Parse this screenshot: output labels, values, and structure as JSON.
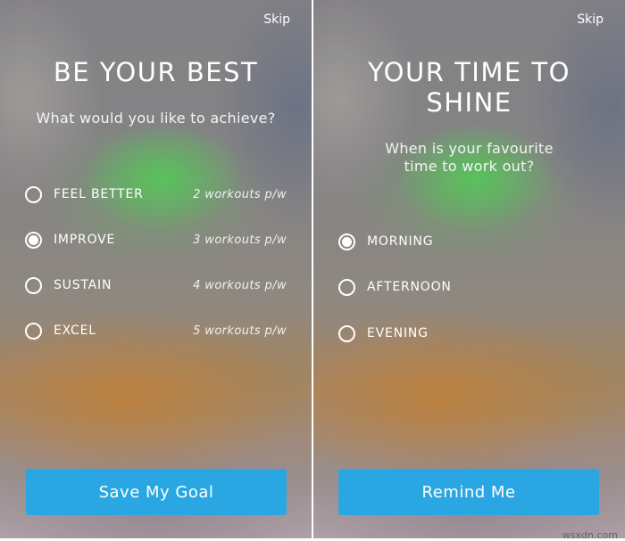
{
  "goal_screen": {
    "skip_label": "Skip",
    "title": "BE YOUR BEST",
    "subtitle": "What would you like to achieve?",
    "options": [
      {
        "label": "FEEL BETTER",
        "meta": "2 workouts p/w",
        "selected": false
      },
      {
        "label": "IMPROVE",
        "meta": "3 workouts p/w",
        "selected": true
      },
      {
        "label": "SUSTAIN",
        "meta": "4 workouts p/w",
        "selected": false
      },
      {
        "label": "EXCEL",
        "meta": "5 workouts p/w",
        "selected": false
      }
    ],
    "button_label": "Save My Goal"
  },
  "time_screen": {
    "skip_label": "Skip",
    "title_line1": "YOUR TIME TO",
    "title_line2": "SHINE",
    "subtitle_line1": "When is your favourite",
    "subtitle_line2": "time to work out?",
    "options": [
      {
        "label": "MORNING",
        "selected": true
      },
      {
        "label": "AFTERNOON",
        "selected": false
      },
      {
        "label": "EVENING",
        "selected": false
      }
    ],
    "button_label": "Remind Me"
  },
  "watermark": "wsxdn.com",
  "colors": {
    "button": "#2aa7e2",
    "text": "#ffffff"
  }
}
